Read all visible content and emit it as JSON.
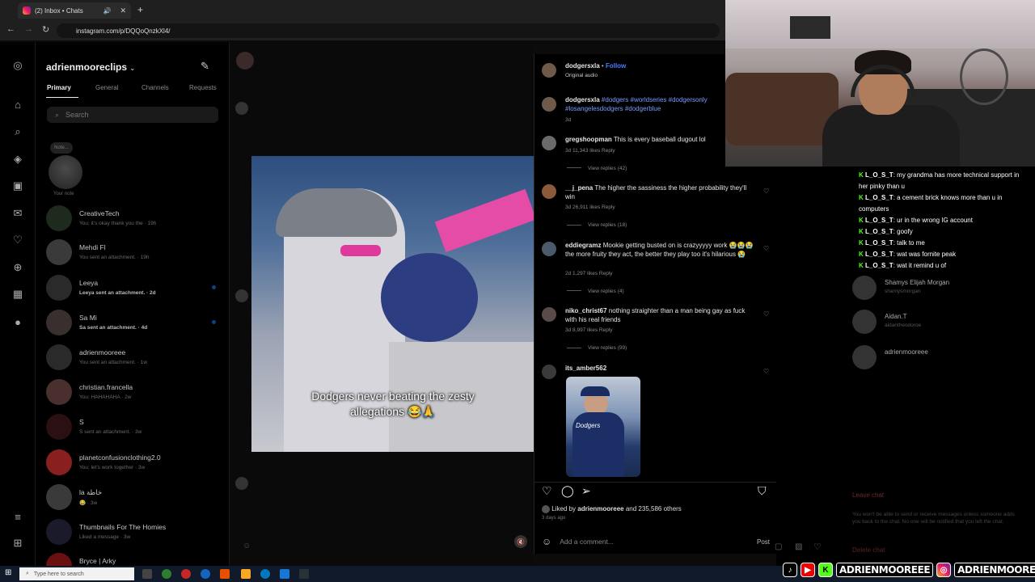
{
  "browser": {
    "tab_title": "(2) Inbox • Chats",
    "url": "instagram.com/p/DQQoQnzkXl4/"
  },
  "inbox": {
    "username": "adrienmooreclips",
    "tabs": [
      "Primary",
      "General",
      "Channels",
      "Requests"
    ],
    "search_placeholder": "Search",
    "note_bubble": "Note...",
    "note_label": "Your note",
    "chats": [
      {
        "name": "CreativeTech",
        "preview": "You: it's okay thank you the · 19h",
        "unread": false
      },
      {
        "name": "Mehdi Fl",
        "preview": "You sent an attachment. · 19h",
        "unread": false
      },
      {
        "name": "Leeya",
        "preview": "Leeya sent an attachment. · 2d",
        "unread": true
      },
      {
        "name": "Sa Mi",
        "preview": "Sa sent an attachment. · 4d",
        "unread": true
      },
      {
        "name": "adrienmooreee",
        "preview": "You sent an attachment. · 1w",
        "unread": false
      },
      {
        "name": "christian.francella",
        "preview": "You: HAHAHAHA · 2w",
        "unread": false
      },
      {
        "name": "S",
        "preview": "S sent an attachment. · 3w",
        "unread": false
      },
      {
        "name": "planetconfusionclothing2.0",
        "preview": "You: let's work together · 3w",
        "unread": false
      },
      {
        "name": "la خاطة",
        "preview": "😂 · 3w",
        "unread": false
      },
      {
        "name": "Thumbnails For The Homies",
        "preview": "Liked a message · 3w",
        "unread": false
      },
      {
        "name": "Bryce | Arky",
        "preview": "",
        "unread": false
      }
    ]
  },
  "post": {
    "author": "dodgersxla",
    "follow": "Follow",
    "audio": "Original audio",
    "caption_user": "dodgersxla",
    "caption_tags": "#dodgers #worldseries #dodgersonly #losangelesdodgers #dodgerblue",
    "caption_age": "3d",
    "video_caption": "Dodgers never beating the zesty allegations 😂🙏",
    "mute_icon": "🔇",
    "comments": [
      {
        "user": "gregshoopman",
        "text": "This is every baseball dugout lol",
        "meta": "3d   11,343 likes   Reply",
        "replies": "View replies (42)"
      },
      {
        "user": "__j_pena",
        "text": "The higher the sassiness the higher probability they'll win",
        "meta": "3d   26,911 likes   Reply",
        "replies": "View replies (18)"
      },
      {
        "user": "eddiegramz",
        "text": "Mookie getting busted on is crazyyyyy work 😭😭😭 the more fruity they act, the better they play too it's hilarious 😭",
        "meta": "2d   1,297 likes   Reply",
        "replies": "View replies (4)"
      },
      {
        "user": "niko_christ67",
        "text": "nothing straighter than a man being gay as fuck with his real friends",
        "meta": "3d   8,997 likes   Reply",
        "replies": "View replies (99)"
      },
      {
        "user": "its_amber562",
        "text": "",
        "meta": "",
        "replies": ""
      }
    ],
    "liked_by_prefix": "Liked by",
    "liked_by_user": "adrienmooreee",
    "liked_by_suffix": "and 235,586 others",
    "posted_ago": "3 days ago",
    "add_comment_placeholder": "Add a comment...",
    "post_button": "Post",
    "thumb_text": "Dodgers"
  },
  "live_chat": [
    {
      "user": "L_O_S_T",
      "msg": ": my grandma has more technical support in her pinky than u"
    },
    {
      "user": "L_O_S_T",
      "msg": ": a cement brick knows more than u in computers"
    },
    {
      "user": "L_O_S_T",
      "msg": ": ur in the wrong IG account"
    },
    {
      "user": "L_O_S_T",
      "msg": ": goofy"
    },
    {
      "user": "L_O_S_T",
      "msg": ": talk to me"
    },
    {
      "user": "L_O_S_T",
      "msg": ": wat was fornite peak"
    },
    {
      "user": "L_O_S_T",
      "msg": ": wat it remind u of"
    }
  ],
  "dm_details": {
    "members": [
      {
        "name": "Shamys Elijah Morgan",
        "handle": "shamysmorgan"
      },
      {
        "name": "Aidan.T",
        "handle": "aidantheodoroe"
      },
      {
        "name": "adrienmooreee",
        "handle": ""
      }
    ],
    "leave_chat": "Leave chat",
    "leave_note": "You won't be able to send or receive messages unless someone adds you back to the chat. No one will be notified that you left the chat.",
    "delete_chat": "Delete chat"
  },
  "taskbar": {
    "search_placeholder": "Type here to search"
  },
  "socials": {
    "handle1": "ADRIENMOOREEE",
    "handle2": "ADRIENMOORECLIPS"
  },
  "colors": {
    "accent_blue": "#1877f2",
    "follow_blue": "#4a7dff",
    "hashtag_blue": "#7a9cff"
  }
}
